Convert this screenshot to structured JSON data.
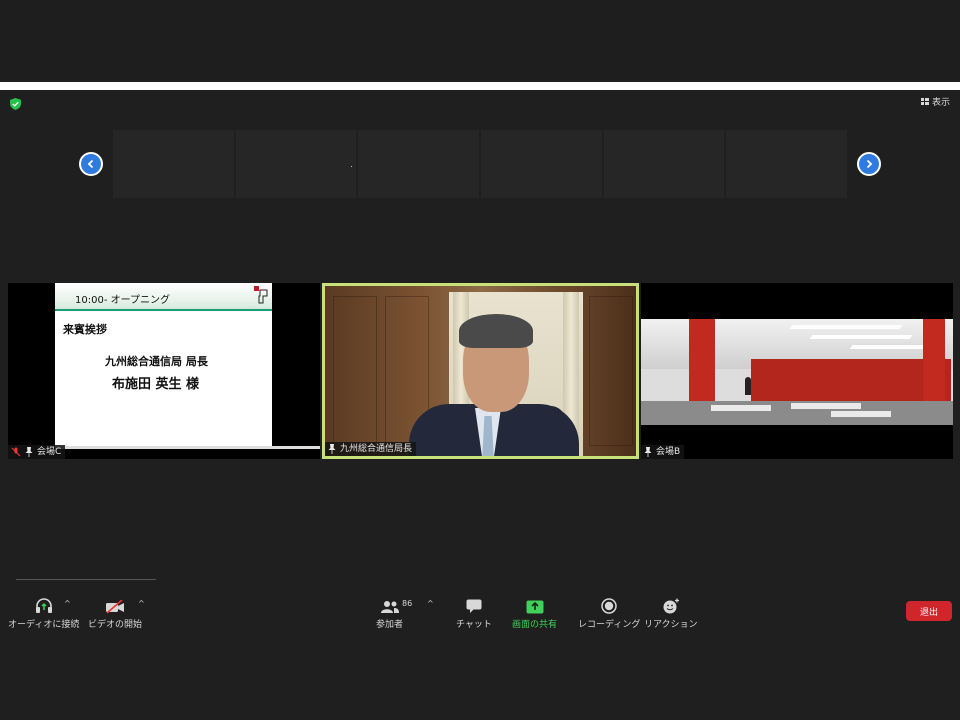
{
  "view": {
    "label": "表示"
  },
  "slide": {
    "time_title": "10:00- オープニング",
    "line1": "来賓挨拶",
    "line2": "九州総合通信局 局長",
    "line3": "布施田 英生 様"
  },
  "tiles": [
    {
      "name": "会場C"
    },
    {
      "name": "九州総合通信局長"
    },
    {
      "name": "会場B"
    }
  ],
  "toolbar": {
    "audio": "オーディオに接続",
    "video": "ビデオの開始",
    "participants": "参加者",
    "participants_count": "86",
    "chat": "チャット",
    "share": "画面の共有",
    "record": "レコーディング",
    "reaction": "リアクション",
    "leave": "退出"
  },
  "colors": {
    "active_speaker": "#c7e07a",
    "share_green": "#3fd15a",
    "leave_red": "#d0262b",
    "nav_blue": "#2f7be0"
  }
}
